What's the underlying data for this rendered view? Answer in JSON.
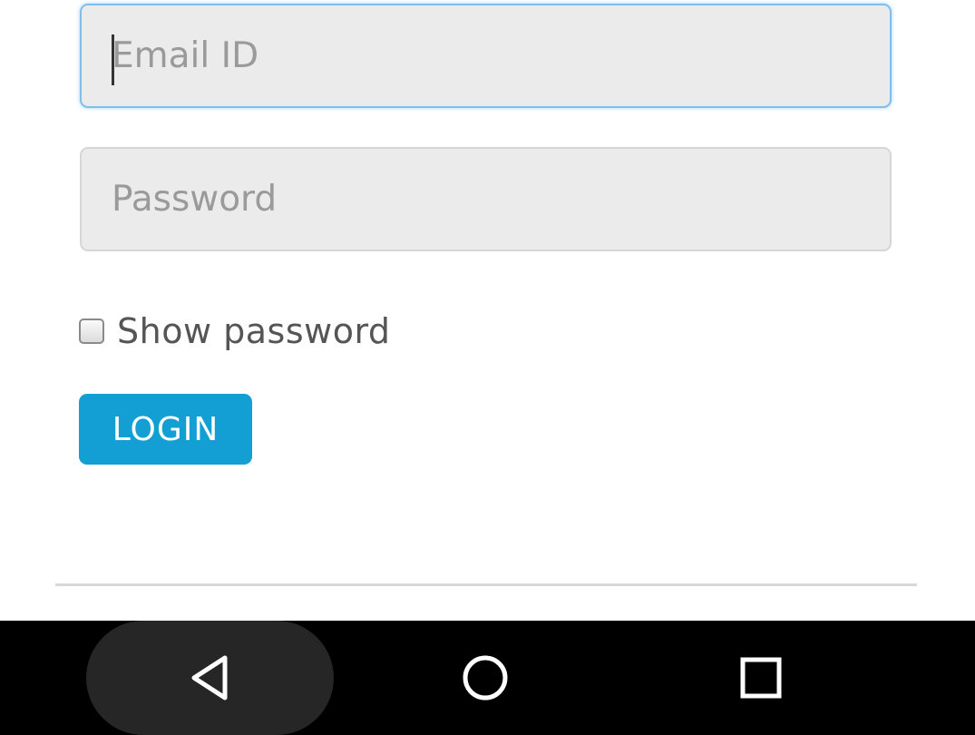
{
  "login_form": {
    "email_placeholder": "Email ID",
    "email_value": "",
    "password_placeholder": "Password",
    "password_value": "",
    "show_password_label": "Show password",
    "show_password_checked": false,
    "login_label": "LOGIN"
  },
  "navbar": {
    "back_icon": "back-triangle-icon",
    "home_icon": "home-circle-icon",
    "recent_icon": "recent-apps-square-icon"
  },
  "colors": {
    "login_button": "#139fd4",
    "focus_border": "#7fbfe8",
    "field_background": "#ebebeb",
    "navbar_background": "#000000"
  }
}
